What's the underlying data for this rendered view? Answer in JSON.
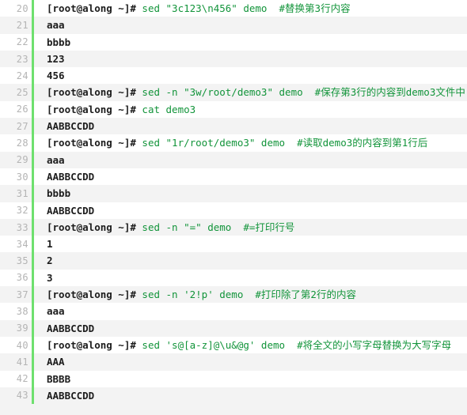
{
  "theme": {
    "background": "#ffffff",
    "alt_row_background": "#f3f3f3",
    "gutter_bar_color": "#6ee06e",
    "line_number_color": "#b4b4b4",
    "prompt_color": "#1c1c1c",
    "command_color": "#12943a",
    "comment_color": "#12943a",
    "output_color": "#1c1c1c"
  },
  "lines": [
    {
      "number": "20",
      "prompt": "[root@along ~]# ",
      "command": "sed \"3c123\\n456\" demo",
      "comment": "  #替换第3行内容",
      "output": ""
    },
    {
      "number": "21",
      "prompt": "",
      "command": "",
      "comment": "",
      "output": "aaa"
    },
    {
      "number": "22",
      "prompt": "",
      "command": "",
      "comment": "",
      "output": "bbbb"
    },
    {
      "number": "23",
      "prompt": "",
      "command": "",
      "comment": "",
      "output": "123"
    },
    {
      "number": "24",
      "prompt": "",
      "command": "",
      "comment": "",
      "output": "456"
    },
    {
      "number": "25",
      "prompt": "[root@along ~]# ",
      "command": "sed -n \"3w/root/demo3\" demo",
      "comment": "  #保存第3行的内容到demo3文件中",
      "output": ""
    },
    {
      "number": "26",
      "prompt": "[root@along ~]# ",
      "command": "cat demo3",
      "comment": "",
      "output": ""
    },
    {
      "number": "27",
      "prompt": "",
      "command": "",
      "comment": "",
      "output": "AABBCCDD"
    },
    {
      "number": "28",
      "prompt": "[root@along ~]# ",
      "command": "sed \"1r/root/demo3\" demo",
      "comment": "  #读取demo3的内容到第1行后",
      "output": ""
    },
    {
      "number": "29",
      "prompt": "",
      "command": "",
      "comment": "",
      "output": "aaa"
    },
    {
      "number": "30",
      "prompt": "",
      "command": "",
      "comment": "",
      "output": "AABBCCDD"
    },
    {
      "number": "31",
      "prompt": "",
      "command": "",
      "comment": "",
      "output": "bbbb"
    },
    {
      "number": "32",
      "prompt": "",
      "command": "",
      "comment": "",
      "output": "AABBCCDD"
    },
    {
      "number": "33",
      "prompt": "[root@along ~]# ",
      "command": "sed -n \"=\" demo",
      "comment": "  #=打印行号",
      "output": ""
    },
    {
      "number": "34",
      "prompt": "",
      "command": "",
      "comment": "",
      "output": "1"
    },
    {
      "number": "35",
      "prompt": "",
      "command": "",
      "comment": "",
      "output": "2"
    },
    {
      "number": "36",
      "prompt": "",
      "command": "",
      "comment": "",
      "output": "3"
    },
    {
      "number": "37",
      "prompt": "[root@along ~]# ",
      "command": "sed -n '2!p' demo",
      "comment": "  #打印除了第2行的内容",
      "output": ""
    },
    {
      "number": "38",
      "prompt": "",
      "command": "",
      "comment": "",
      "output": "aaa"
    },
    {
      "number": "39",
      "prompt": "",
      "command": "",
      "comment": "",
      "output": "AABBCCDD"
    },
    {
      "number": "40",
      "prompt": "[root@along ~]# ",
      "command": "sed 's@[a-z]@\\u&@g' demo",
      "comment": "  #将全文的小写字母替换为大写字母",
      "output": ""
    },
    {
      "number": "41",
      "prompt": "",
      "command": "",
      "comment": "",
      "output": "AAA"
    },
    {
      "number": "42",
      "prompt": "",
      "command": "",
      "comment": "",
      "output": "BBBB"
    },
    {
      "number": "43",
      "prompt": "",
      "command": "",
      "comment": "",
      "output": "AABBCCDD"
    }
  ]
}
